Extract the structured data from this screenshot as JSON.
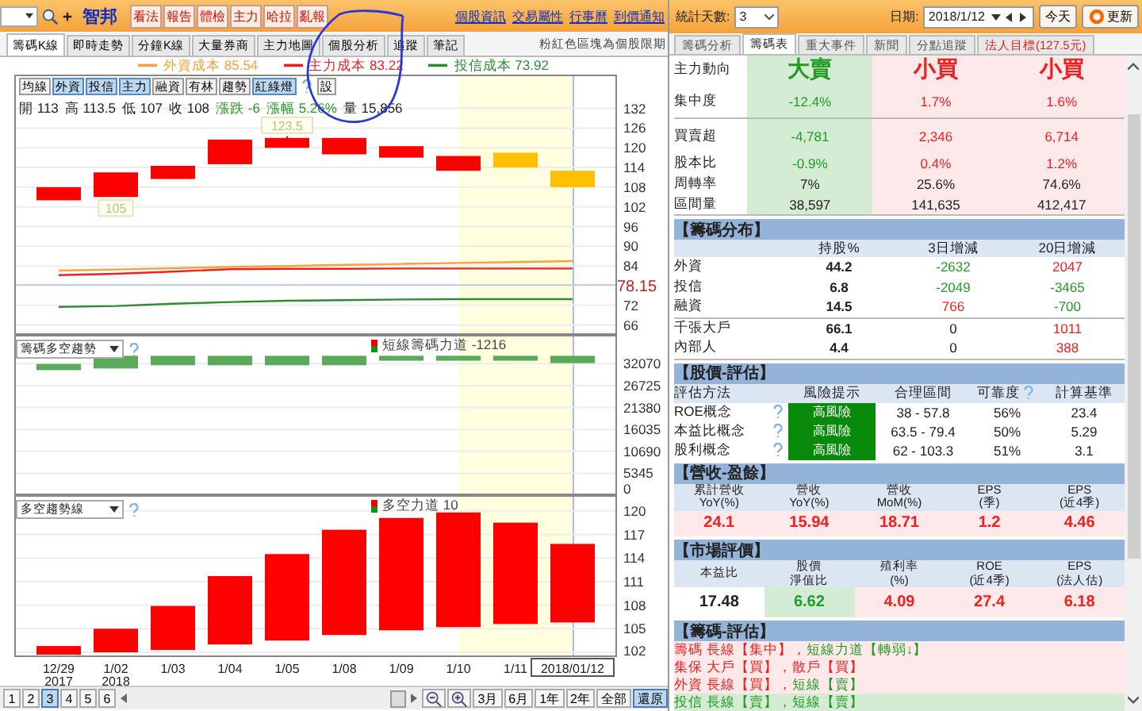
{
  "header": {
    "stock_name": "智邦",
    "buttons": [
      "看法",
      "報告",
      "體檢",
      "主力",
      "哈拉",
      "亂報"
    ],
    "links": [
      "個股資訊",
      "交易屬性",
      "行事曆",
      "到價通知"
    ]
  },
  "tabs": [
    {
      "label": "籌碼K線",
      "selected": true
    },
    {
      "label": "即時走勢",
      "selected": false
    },
    {
      "label": "分鐘K線",
      "selected": false
    },
    {
      "label": "大量券商",
      "selected": false
    },
    {
      "label": "主力地圖",
      "selected": false
    },
    {
      "label": "個股分析",
      "selected": false
    },
    {
      "label": "追蹤",
      "selected": false
    },
    {
      "label": "筆記",
      "selected": false
    }
  ],
  "notice": "粉紅色區塊為個股限期",
  "price_panel": {
    "toolbar": [
      {
        "label": "均線",
        "on": false
      },
      {
        "label": "外資",
        "on": true
      },
      {
        "label": "投信",
        "on": true
      },
      {
        "label": "主力",
        "on": true
      },
      {
        "label": "融資",
        "on": false
      },
      {
        "label": "有林",
        "on": false
      },
      {
        "label": "趨勢",
        "on": false
      },
      {
        "label": "紅綠燈",
        "on": true
      },
      {
        "label": "設",
        "on": false
      }
    ],
    "quote": [
      {
        "text": "開 113",
        "kind": "flat"
      },
      {
        "text": "高 113.5",
        "kind": "flat"
      },
      {
        "text": "低 107",
        "kind": "flat"
      },
      {
        "text": "收 108",
        "kind": "flat"
      },
      {
        "text": "漲跌 -6",
        "kind": "down"
      },
      {
        "text": "漲幅 5.26%",
        "kind": "down"
      },
      {
        "text": "量 15,856",
        "kind": "flat"
      }
    ],
    "legend_values": [
      "85.54",
      "83.22",
      "73.92"
    ],
    "chart_data": {
      "type": "candlestick",
      "grid": true,
      "ylim": [
        63,
        142.3
      ],
      "yticks": [
        132,
        126,
        120,
        114,
        108,
        102,
        96,
        90,
        84,
        72,
        66
      ],
      "series": [
        {
          "color": "#ff0000",
          "ohlc": [
            [
              108,
              108,
              104,
              104
            ],
            [
              112.5,
              112.5,
              105,
              105
            ],
            [
              114.5,
              114.5,
              110.5,
              110.5
            ],
            [
              122.5,
              122.5,
              115,
              115
            ],
            [
              123,
              123.5,
              120,
              120
            ],
            [
              123,
              123,
              118,
              118
            ],
            [
              120.5,
              120.5,
              117,
              117
            ],
            [
              117.5,
              117.5,
              113,
              113
            ],
            null,
            null
          ]
        },
        {
          "color": "#ffc000",
          "ohlc": [
            null,
            null,
            null,
            null,
            null,
            null,
            null,
            null,
            [
              118.5,
              118.5,
              114,
              114
            ],
            [
              113,
              113,
              108,
              108
            ]
          ]
        },
        {
          "name": "外資成本",
          "type": "line",
          "color": "#f7a13a",
          "values": [
            82.6,
            82.9,
            83.3,
            83.7,
            84.0,
            84.3,
            84.6,
            84.9,
            85.2,
            85.5
          ]
        },
        {
          "name": "主力成本",
          "type": "line",
          "color": "#f02020",
          "values": [
            81.2,
            81.6,
            82.3,
            83.0,
            83.1,
            83.1,
            83.2,
            83.2,
            83.2,
            83.2
          ]
        },
        {
          "name": "投信成本",
          "type": "line",
          "color": "#2e8b2e",
          "values": [
            71.5,
            71.8,
            72.5,
            73.0,
            73.4,
            73.6,
            73.8,
            73.9,
            73.9,
            73.9
          ]
        }
      ],
      "ref_lines": [
        {
          "axis": "y",
          "value": 78.15,
          "label": "78.15"
        }
      ],
      "annotations": [
        "123.5",
        "105"
      ]
    }
  },
  "chip_panel": {
    "select": "籌碼多空趨勢",
    "legend": {
      "label": "短線籌碼力道",
      "value": "-1216"
    },
    "chart_data": {
      "type": "candlestick",
      "grid": true,
      "ylim": [
        0,
        39100
      ],
      "yticks": [
        32070,
        26725,
        21380,
        16035,
        10690,
        5345,
        0
      ],
      "series": [
        {
          "color": "#5aaa5a",
          "ohlc": [
            [
              30500,
              32000,
              30500,
              32000
            ],
            [
              30900,
              34000,
              30900,
              34000
            ],
            [
              31700,
              34000,
              31700,
              34000
            ],
            [
              31700,
              34000,
              31700,
              34000
            ],
            [
              31700,
              34000,
              31700,
              34000
            ],
            [
              31700,
              34000,
              31700,
              34000
            ],
            [
              32800,
              34000,
              32800,
              34000
            ],
            [
              32800,
              34000,
              32800,
              34000
            ],
            [
              32800,
              34000,
              32800,
              34000
            ],
            [
              32200,
              34000,
              32200,
              34000
            ]
          ]
        }
      ]
    }
  },
  "trend_panel": {
    "select": "多空趨勢線",
    "legend": {
      "label": "多空力道",
      "value": "10"
    },
    "chart_data": {
      "type": "candlestick",
      "grid": true,
      "ylim": [
        101.4,
        122
      ],
      "yticks": [
        120,
        117,
        114,
        111,
        108,
        105,
        102
      ],
      "categories": [
        "12/29",
        "1/02",
        "1/03",
        "1/04",
        "1/05",
        "1/08",
        "1/09",
        "1/10",
        "1/11",
        "2018/01/12"
      ],
      "series": [
        {
          "color": "#ff0000",
          "ohlc": [
            [
              101.7,
              102.8,
              101.7,
              102.8
            ],
            [
              102,
              105,
              102,
              105
            ],
            [
              102.3,
              107.9,
              102.3,
              107.9
            ],
            [
              103,
              111.7,
              103,
              111.7
            ],
            [
              103.5,
              114.5,
              103.5,
              114.5
            ],
            [
              104.2,
              117.6,
              104.2,
              117.6
            ],
            [
              104.8,
              119.1,
              104.8,
              119.1
            ],
            [
              105.2,
              119.8,
              105.2,
              119.8
            ],
            [
              105.6,
              118.5,
              105.6,
              118.5
            ],
            [
              105.8,
              115.8,
              105.8,
              115.8
            ]
          ]
        }
      ],
      "annotations": [
        "2017",
        "2018"
      ]
    }
  },
  "nav": {
    "pages": [
      {
        "label": "1",
        "selected": false
      },
      {
        "label": "2",
        "selected": false
      },
      {
        "label": "3",
        "selected": true
      },
      {
        "label": "4",
        "selected": false
      },
      {
        "label": "5",
        "selected": false
      },
      {
        "label": "6",
        "selected": false
      }
    ],
    "ranges": [
      {
        "label": "3月",
        "selected": false
      },
      {
        "label": "6月",
        "selected": false
      },
      {
        "label": "1年",
        "selected": false
      },
      {
        "label": "2年",
        "selected": false
      },
      {
        "label": "全部",
        "selected": false
      },
      {
        "label": "還原",
        "selected": true
      }
    ]
  },
  "controls": {
    "days_label": "統計天數:",
    "days_value": "3",
    "date_label": "日期:",
    "date_value": "2018/1/12",
    "buttons": [
      "今天",
      "更新"
    ]
  },
  "right_tabs": [
    {
      "label": "籌碼分析",
      "selected": false,
      "kind": "normal"
    },
    {
      "label": "籌碼表",
      "selected": true,
      "kind": "normal"
    },
    {
      "label": "重大事件",
      "selected": false,
      "kind": "normal"
    },
    {
      "label": "新聞",
      "selected": false,
      "kind": "normal"
    },
    {
      "label": "分點追蹤",
      "selected": false,
      "kind": "normal"
    },
    {
      "label": "法人目標(127.5元)",
      "selected": false,
      "kind": "target"
    }
  ],
  "main_table": {
    "header": {
      "label": "主力動向",
      "cells": [
        {
          "text": "大賣",
          "kind": "down"
        },
        {
          "text": "小買",
          "kind": "up"
        },
        {
          "text": "小買",
          "kind": "up"
        }
      ]
    },
    "row_groups": [
      [
        {
          "label": "集中度",
          "cells": [
            {
              "text": "-12.4%",
              "kind": "down"
            },
            {
              "text": "1.7%",
              "kind": "up"
            },
            {
              "text": "1.6%",
              "kind": "up"
            }
          ]
        }
      ],
      [
        {
          "label": "買賣超",
          "cells": [
            {
              "text": "-4,781",
              "kind": "down"
            },
            {
              "text": "2,346",
              "kind": "up"
            },
            {
              "text": "6,714",
              "kind": "up"
            }
          ]
        },
        {
          "label": "股本比",
          "cells": [
            {
              "text": "-0.9%",
              "kind": "down"
            },
            {
              "text": "0.4%",
              "kind": "up"
            },
            {
              "text": "1.2%",
              "kind": "up"
            }
          ]
        },
        {
          "label": "周轉率",
          "cells": [
            {
              "text": "7%",
              "kind": "flat"
            },
            {
              "text": "25.6%",
              "kind": "flat"
            },
            {
              "text": "74.6%",
              "kind": "flat"
            }
          ]
        },
        {
          "label": "區間量",
          "cells": [
            {
              "text": "38,597",
              "kind": "flat"
            },
            {
              "text": "141,635",
              "kind": "flat"
            },
            {
              "text": "412,417",
              "kind": "flat"
            }
          ]
        }
      ]
    ]
  },
  "distribution": {
    "title": "【籌碼分布】",
    "columns": [
      "持股%",
      "3日增減",
      "20日增減"
    ],
    "row_groups": [
      [
        {
          "label": "外資",
          "cells": [
            {
              "text": "44.2",
              "kind": "flat"
            },
            {
              "text": "-2632",
              "kind": "down"
            },
            {
              "text": "2047",
              "kind": "up"
            }
          ]
        },
        {
          "label": "投信",
          "cells": [
            {
              "text": "6.8",
              "kind": "flat"
            },
            {
              "text": "-2049",
              "kind": "down"
            },
            {
              "text": "-3465",
              "kind": "down"
            }
          ]
        },
        {
          "label": "融資",
          "cells": [
            {
              "text": "14.5",
              "kind": "flat"
            },
            {
              "text": "766",
              "kind": "up"
            },
            {
              "text": "-700",
              "kind": "down"
            }
          ]
        }
      ],
      [
        {
          "label": "千張大戶",
          "cells": [
            {
              "text": "66.1",
              "kind": "flat"
            },
            {
              "text": "0",
              "kind": "flat"
            },
            {
              "text": "1011",
              "kind": "up"
            }
          ]
        },
        {
          "label": "內部人",
          "cells": [
            {
              "text": "4.4",
              "kind": "flat"
            },
            {
              "text": "0",
              "kind": "flat"
            },
            {
              "text": "388",
              "kind": "up"
            }
          ]
        }
      ]
    ]
  },
  "valuation": {
    "title": "【股價-評估】",
    "columns": [
      "評估方法",
      "風險提示",
      "合理區間",
      "可靠度",
      "計算基準"
    ],
    "rows": [
      {
        "label": "ROE概念",
        "risk": "高風險",
        "range": "38 - 57.8",
        "reliability": "56%",
        "base": "23.4"
      },
      {
        "label": "本益比概念",
        "risk": "高風險",
        "range": "63.5 - 79.4",
        "reliability": "50%",
        "base": "5.29"
      },
      {
        "label": "股利概念",
        "risk": "高風險",
        "range": "62 - 103.3",
        "reliability": "51%",
        "base": "3.1"
      }
    ]
  },
  "revenue": {
    "title": "【營收-盈餘】",
    "columns": [
      [
        "累計營收",
        "YoY(%)"
      ],
      [
        "營收",
        "YoY(%)"
      ],
      [
        "營收",
        "MoM(%)"
      ],
      [
        "EPS",
        "(季)"
      ],
      [
        "EPS",
        "(近4季)"
      ]
    ],
    "values": [
      {
        "text": "24.1",
        "kind": "up"
      },
      {
        "text": "15.94",
        "kind": "up"
      },
      {
        "text": "18.71",
        "kind": "up"
      },
      {
        "text": "1.2",
        "kind": "up"
      },
      {
        "text": "4.46",
        "kind": "up"
      }
    ]
  },
  "market": {
    "title": "【市場評價】",
    "columns": [
      [
        "本益比"
      ],
      [
        "股價",
        "淨值比"
      ],
      [
        "殖利率",
        "(%)"
      ],
      [
        "ROE",
        "(近4季)"
      ],
      [
        "EPS",
        "(法人估)"
      ]
    ],
    "values": [
      {
        "text": "17.48",
        "kind": "flat"
      },
      {
        "text": "6.62",
        "kind": "down"
      },
      {
        "text": "4.09",
        "kind": "up"
      },
      {
        "text": "27.4",
        "kind": "up"
      },
      {
        "text": "6.18",
        "kind": "up"
      }
    ]
  },
  "chip_eval": {
    "title": "【籌碼-評估】",
    "lines": [
      {
        "kind": "up",
        "segments": [
          {
            "text": "籌碼 長線【集中】，",
            "kind": "up"
          },
          {
            "text": "短線力道【轉弱↓】",
            "kind": "down"
          }
        ]
      },
      {
        "kind": "up",
        "segments": [
          {
            "text": "集保 大戶【買】，散戶【買】",
            "kind": "up"
          }
        ]
      },
      {
        "kind": "up",
        "segments": [
          {
            "text": "外資 長線【買】，",
            "kind": "up"
          },
          {
            "text": "短線【賣】",
            "kind": "down"
          }
        ]
      },
      {
        "kind": "down",
        "segments": [
          {
            "text": "投信 長線【賣】，短線【賣】",
            "kind": "down"
          }
        ]
      }
    ]
  }
}
